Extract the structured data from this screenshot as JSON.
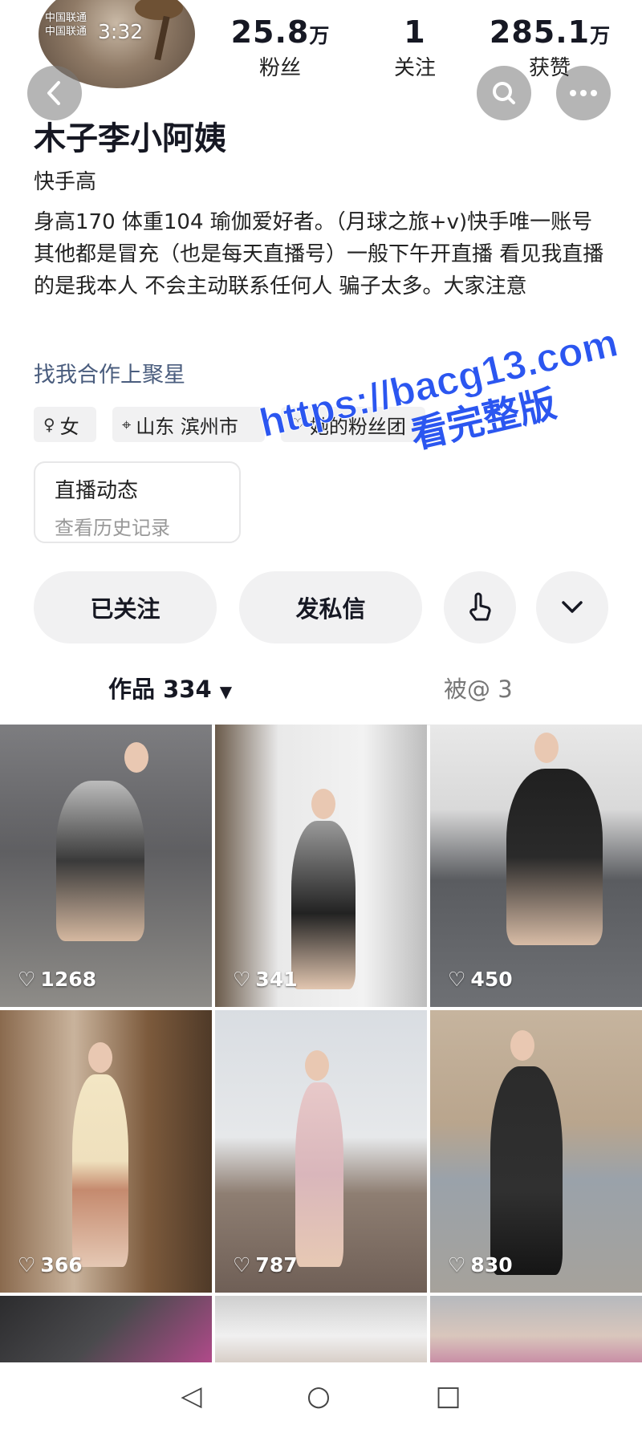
{
  "status": {
    "carrier_line1": "中国联通",
    "carrier_line2": "中国联通",
    "time": "3:32"
  },
  "stats": {
    "fans": {
      "value": "25.8",
      "unit": "万",
      "label": "粉丝"
    },
    "following": {
      "value": "1",
      "label": "关注"
    },
    "likes": {
      "value": "285.1",
      "unit": "万",
      "label": "获赞"
    }
  },
  "profile": {
    "name": "木子李小阿姨",
    "bio_line1": "快手高",
    "bio_body": "身高170 体重104 瑜伽爱好者。（月球之旅+v)快手唯一账号 其他都是冒充（也是每天直播号）一般下午开直播 看见我直播的是我本人 不会主动联系任何人 骗子太多。大家注意",
    "link": "找我合作上聚星",
    "tags": {
      "gender": "女",
      "location": "山东 滨州市",
      "fanclub": "她的粉丝团"
    }
  },
  "live_card": {
    "title": "直播动态",
    "subtitle": "查看历史记录"
  },
  "watermark": {
    "url": "https://bacg13.com",
    "text": "看完整版"
  },
  "actions": {
    "followed": "已关注",
    "message": "发私信"
  },
  "tabs": {
    "works": "作品 334",
    "mentions": "被@ 3"
  },
  "videos": [
    {
      "likes": "1268"
    },
    {
      "likes": "341"
    },
    {
      "likes": "450"
    },
    {
      "likes": "366"
    },
    {
      "likes": "787"
    },
    {
      "likes": "830"
    }
  ],
  "icons": {
    "back": "chevron-left-icon",
    "search": "search-icon",
    "more": "more-dots-icon",
    "poke": "finger-tap-icon",
    "expand": "chevron-down-icon",
    "heart": "heart-icon"
  },
  "colors": {
    "link": "#4a5d7e",
    "watermark": "#2b56f0",
    "tag_bg": "#f1f1f2"
  }
}
